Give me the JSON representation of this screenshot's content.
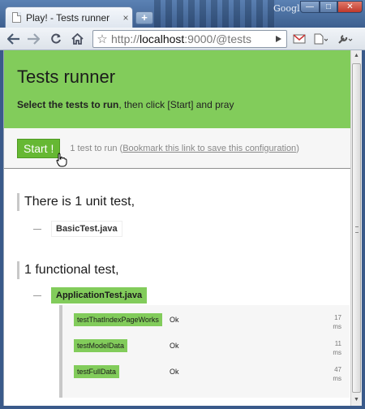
{
  "window": {
    "tab_title": "Play! - Tests runner",
    "tab_close": "×",
    "newtab": "+",
    "google_label": "Google",
    "minimize": "—",
    "maximize": "□",
    "close": "✕"
  },
  "toolbar": {
    "url_prefix": "http://",
    "url_host": "localhost",
    "url_rest": ":9000/@tests"
  },
  "header": {
    "title": "Tests runner",
    "subtitle_bold": "Select the tests to run",
    "subtitle_rest": ", then click [Start] and pray"
  },
  "actions": {
    "start_label": "Start !",
    "count_text": "1 test to run",
    "open_paren": " (",
    "bookmark_link": "Bookmark this link to save this configuration",
    "close_paren": ")"
  },
  "unit_section": {
    "heading": "There is 1 unit test,",
    "file": "BasicTest.java"
  },
  "functional_section": {
    "heading": "1 functional test,",
    "file": "ApplicationTest.java",
    "results": [
      {
        "name": "testThatIndexPageWorks",
        "status": "Ok",
        "time": "17",
        "unit": "ms"
      },
      {
        "name": "testModelData",
        "status": "Ok",
        "time": "11",
        "unit": "ms"
      },
      {
        "name": "testFullData",
        "status": "Ok",
        "time": "47",
        "unit": "ms"
      }
    ]
  },
  "colors": {
    "accent_green": "#82cc5b",
    "button_green": "#66b833"
  }
}
